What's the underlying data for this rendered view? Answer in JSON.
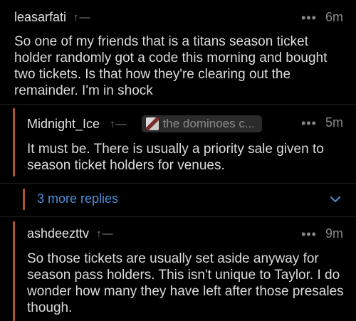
{
  "comments": [
    {
      "username": "leasarfati",
      "vote": "↑—",
      "time": "6m",
      "dots": "•••",
      "text": "So one of my friends that is a titans season ticket holder randomly got a code this morning and bought two tickets. Is that how they're clearing out the remainder. I'm in shock"
    },
    {
      "username": "Midnight_Ice",
      "vote": "↑—",
      "flair": "the dominoes c...",
      "time": "5m",
      "dots": "•••",
      "text": "It must be. There is usually a priority sale given to season ticket holders for venues."
    },
    {
      "username": "ashdeezttv",
      "vote": "↑—",
      "time": "9m",
      "dots": "•••",
      "text": "So those tickets are usually set aside anyway for season pass holders. This isn't unique to Taylor. I do wonder how many they have left after those presales though."
    }
  ],
  "more_replies": {
    "label": "3 more replies"
  },
  "colors": {
    "thread_bar": "#b3522f",
    "link": "#4d8fd8",
    "background": "#000000"
  }
}
